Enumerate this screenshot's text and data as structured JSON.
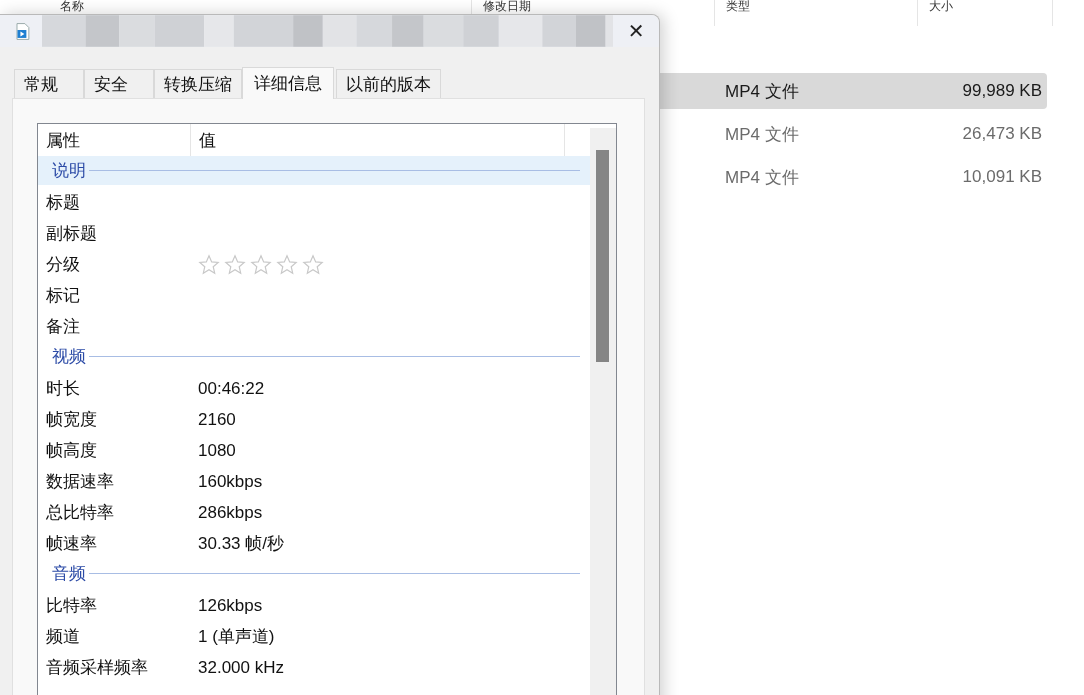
{
  "explorer": {
    "columns": [
      "名称",
      "修改日期",
      "类型",
      "大小"
    ],
    "files": [
      {
        "type": "MP4 文件",
        "size": "99,989 KB",
        "selected": true
      },
      {
        "type": "MP4 文件",
        "size": "26,473 KB",
        "selected": false
      },
      {
        "type": "MP4 文件",
        "size": "10,091 KB",
        "selected": false
      }
    ]
  },
  "dialog": {
    "close": "✕",
    "tabs": [
      {
        "label": "常规",
        "selected": false
      },
      {
        "label": "安全",
        "selected": false
      },
      {
        "label": "转换压缩",
        "selected": false
      },
      {
        "label": "详细信息",
        "selected": true
      },
      {
        "label": "以前的版本",
        "selected": false
      }
    ],
    "columns": [
      "属性",
      "值"
    ],
    "rows": [
      {
        "kind": "group",
        "label": "说明",
        "selected": true
      },
      {
        "kind": "property",
        "name": "标题"
      },
      {
        "kind": "property",
        "name": "副标题"
      },
      {
        "kind": "rating",
        "name": "分级",
        "stars": 0
      },
      {
        "kind": "property",
        "name": "标记"
      },
      {
        "kind": "property",
        "name": "备注"
      },
      {
        "kind": "group",
        "label": "视频",
        "selected": false
      },
      {
        "kind": "property",
        "name": "时长",
        "value": "00:46:22"
      },
      {
        "kind": "property",
        "name": "帧宽度",
        "value": "2160"
      },
      {
        "kind": "property",
        "name": "帧高度",
        "value": "1080"
      },
      {
        "kind": "property",
        "name": "数据速率",
        "value": "160kbps"
      },
      {
        "kind": "property",
        "name": "总比特率",
        "value": "286kbps"
      },
      {
        "kind": "property",
        "name": "帧速率",
        "value": "30.33 帧/秒"
      },
      {
        "kind": "group",
        "label": "音频",
        "selected": false
      },
      {
        "kind": "property",
        "name": "比特率",
        "value": "126kbps"
      },
      {
        "kind": "property",
        "name": "频道",
        "value": "1 (单声道)"
      },
      {
        "kind": "property",
        "name": "音频采样频率",
        "value": "32.000 kHz"
      }
    ]
  }
}
